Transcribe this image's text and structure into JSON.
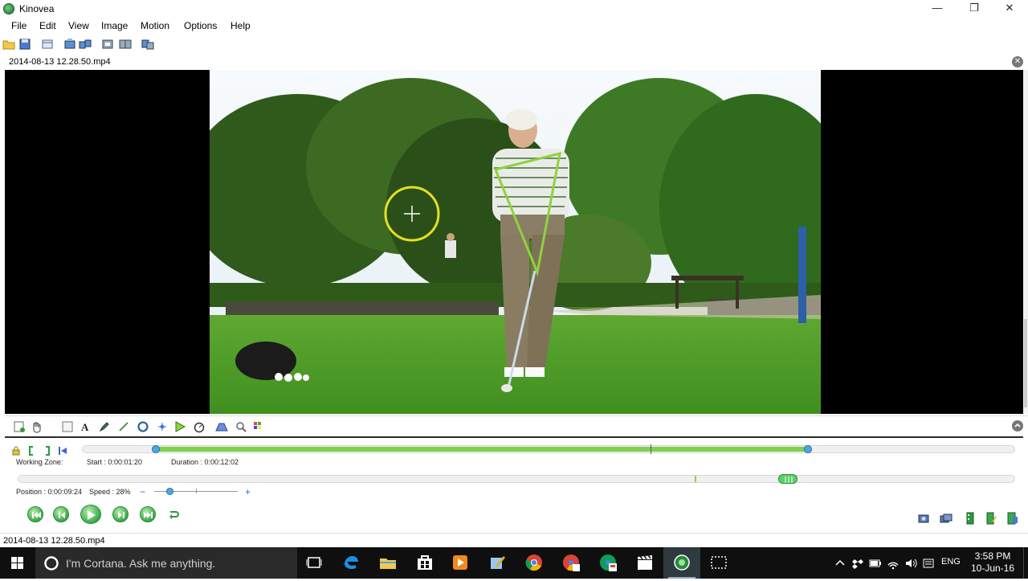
{
  "window": {
    "title": "Kinovea",
    "minimize": "—",
    "maximize": "❐",
    "close": "✕"
  },
  "menu": [
    "File",
    "Edit",
    "View",
    "Image",
    "Motion",
    "Options",
    "Help"
  ],
  "file_header": {
    "name": "2014-08-13 12.28.50.mp4",
    "close": "✕"
  },
  "working_zone": {
    "label": "Working Zone:",
    "start": "Start : 0:00:01:20",
    "duration": "Duration : 0:00:12:02",
    "start_fraction": 0.074,
    "end_fraction": 0.774
  },
  "position": {
    "label": "Position : 0:00:09:24",
    "speed": "Speed : 28%",
    "minus": "−",
    "plus": "+",
    "position_fraction": 0.763,
    "speed_percent": 28
  },
  "status_bar": {
    "text": "2014-08-13 12.28.50.mp4"
  },
  "taskbar": {
    "cortana_placeholder": "I'm Cortana. Ask me anything.",
    "language": "ENG",
    "time": "3:58 PM",
    "date": "10-Jun-16"
  },
  "colors": {
    "accent_green": "#8ed33c",
    "angle_yellow": "#e6e020",
    "track_green": "#7fd04f"
  }
}
